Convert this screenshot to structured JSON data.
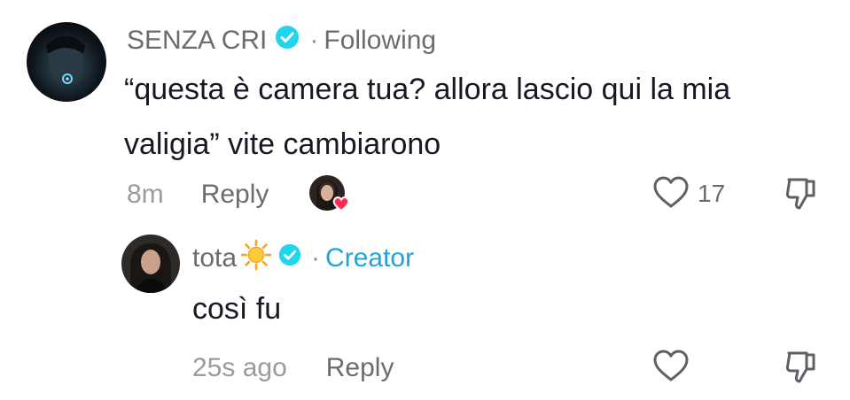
{
  "comment": {
    "username": "SENZA CRI",
    "separator": "·",
    "relation": "Following",
    "text_line1": "“questa è camera tua? allora lascio qui la mia",
    "text_line2": "valigia” vite cambiarono",
    "time": "8m",
    "reply_label": "Reply",
    "like_count": "17",
    "icons": {
      "avatar": "user-avatar",
      "verified": "verified-badge-icon",
      "creator_liked": "creator-liked-avatar",
      "heart": "heart-icon",
      "dislike": "thumbs-down-icon"
    }
  },
  "reply": {
    "username": "tota",
    "emoji": "☀",
    "separator": "·",
    "role": "Creator",
    "text": "così fu",
    "time": "25s ago",
    "reply_label": "Reply"
  },
  "colors": {
    "creator_accent": "#20a4d8",
    "verified_badge": "#20d5ec",
    "like_heart": "#fe2c55"
  }
}
